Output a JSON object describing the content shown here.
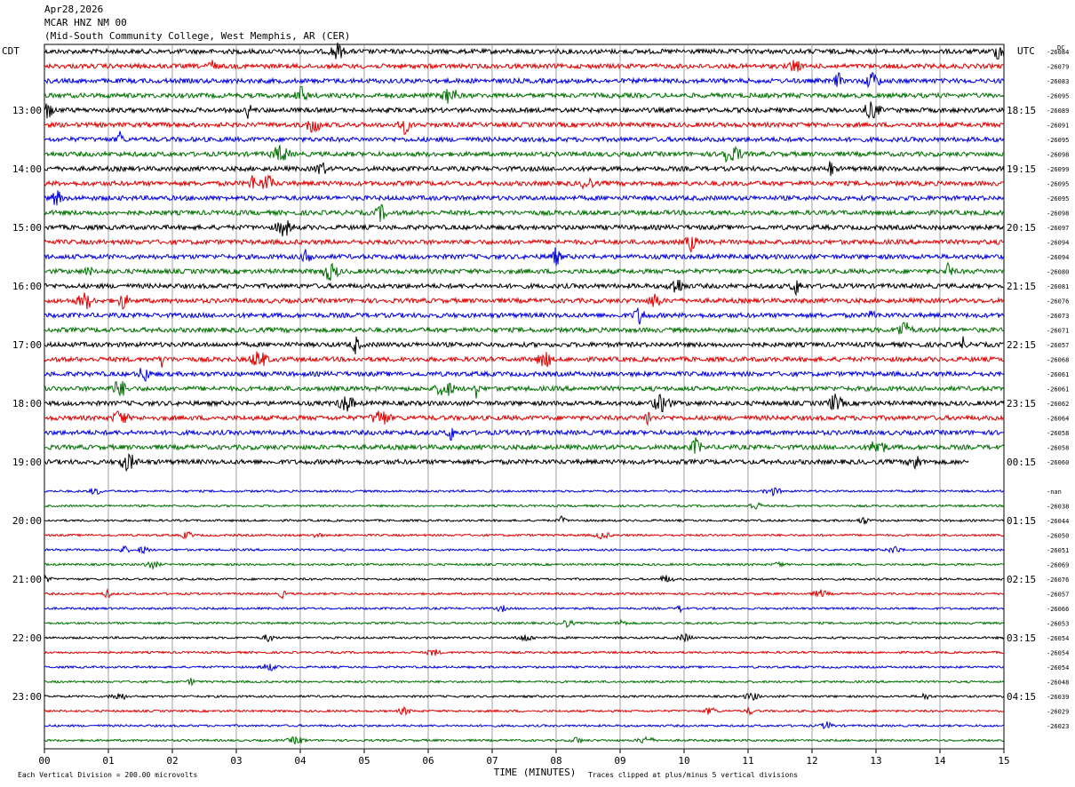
{
  "header": {
    "date": "Apr28,2026",
    "station": "MCAR HNZ NM 00",
    "location": "(Mid-South Community College, West Memphis, AR (CER)"
  },
  "footer": {
    "scale_note": "Each Vertical Division =  200.00 microvolts",
    "clip_note": "Traces clipped at plus/minus 5 vertical divisions"
  },
  "chart_data": {
    "type": "line",
    "title": "",
    "xlabel": "TIME (MINUTES)",
    "left_axis_label": "CDT",
    "right_axis_label": "UTC",
    "xlim": [
      0,
      15
    ],
    "x_ticks": [
      "00",
      "01",
      "02",
      "03",
      "04",
      "05",
      "06",
      "07",
      "08",
      "09",
      "10",
      "11",
      "12",
      "13",
      "14",
      "15"
    ],
    "grid": "vertical lines at each minute",
    "series_colors": [
      "#000000",
      "#e00000",
      "#0000e0",
      "#007000"
    ],
    "left_hour_labels": [
      "13:00",
      "14:00",
      "15:00",
      "16:00",
      "17:00",
      "18:00",
      "19:00",
      "20:00",
      "21:00",
      "22:00",
      "23:00"
    ],
    "right_hour_labels": [
      "18:15",
      "19:15",
      "20:15",
      "21:15",
      "22:15",
      "23:15",
      "00:15",
      "01:15",
      "02:15",
      "03:15",
      "04:15"
    ],
    "row_dc_values": [
      "-26084",
      "-26079",
      "-26083",
      "-26095",
      "-26089",
      "-26091",
      "-26095",
      "-26098",
      "-26099",
      "-26095",
      "-26095",
      "-26098",
      "-26097",
      "-26094",
      "-26094",
      "-26080",
      "-26081",
      "-26076",
      "-26073",
      "-26071",
      "-26057",
      "-26068",
      "-26061",
      "-26061",
      "-26062",
      "-26064",
      "-26058",
      "-26058",
      "-26060",
      "-nan",
      "-26038",
      "-26044",
      "-26050",
      "-26051",
      "-26069",
      "-26076",
      "-26057",
      "-26066",
      "-26053",
      "-26054",
      "-26054",
      "-26054",
      "-26048",
      "-26039",
      "-26029",
      "-26023"
    ],
    "dc_header": "DC",
    "trace_count": 48,
    "gap_row_index": 29,
    "partial_row_end_minute": 14.45
  }
}
